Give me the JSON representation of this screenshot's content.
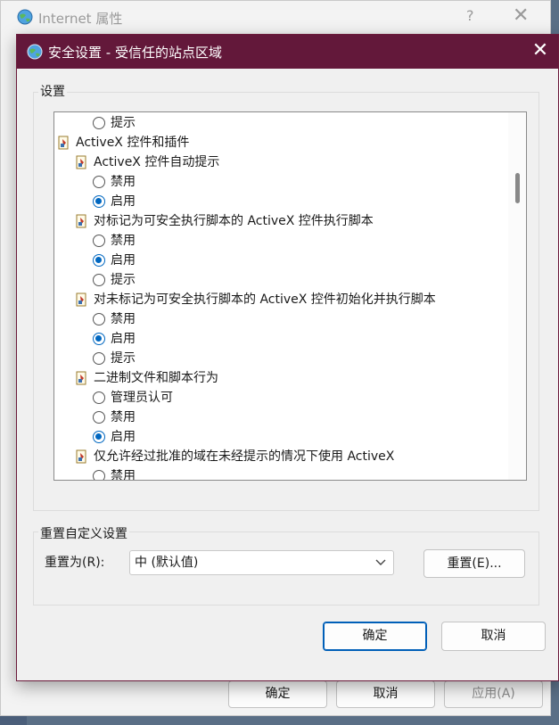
{
  "back_window": {
    "title": "Internet 属性",
    "help_glyph": "?",
    "close_glyph": "✕",
    "buttons": {
      "ok": "确定",
      "cancel": "取消",
      "apply": "应用(A)"
    }
  },
  "dialog": {
    "title": "安全设置 - 受信任的站点区域",
    "close_glyph": "✕",
    "settings_group_label": "设置",
    "tree_items": [
      {
        "type": "radio",
        "label": "提示",
        "checked": false,
        "level": 2
      },
      {
        "type": "folder",
        "label": "ActiveX 控件和插件",
        "level": 0
      },
      {
        "type": "folder",
        "label": "ActiveX 控件自动提示",
        "level": 1
      },
      {
        "type": "radio",
        "label": "禁用",
        "checked": false,
        "level": 2
      },
      {
        "type": "radio",
        "label": "启用",
        "checked": true,
        "level": 2
      },
      {
        "type": "folder",
        "label": "对标记为可安全执行脚本的 ActiveX 控件执行脚本",
        "level": 1
      },
      {
        "type": "radio",
        "label": "禁用",
        "checked": false,
        "level": 2
      },
      {
        "type": "radio",
        "label": "启用",
        "checked": true,
        "level": 2
      },
      {
        "type": "radio",
        "label": "提示",
        "checked": false,
        "level": 2
      },
      {
        "type": "folder",
        "label": "对未标记为可安全执行脚本的 ActiveX 控件初始化并执行脚本",
        "level": 1
      },
      {
        "type": "radio",
        "label": "禁用",
        "checked": false,
        "level": 2
      },
      {
        "type": "radio",
        "label": "启用",
        "checked": true,
        "level": 2
      },
      {
        "type": "radio",
        "label": "提示",
        "checked": false,
        "level": 2
      },
      {
        "type": "folder",
        "label": "二进制文件和脚本行为",
        "level": 1
      },
      {
        "type": "radio",
        "label": "管理员认可",
        "checked": false,
        "level": 2
      },
      {
        "type": "radio",
        "label": "禁用",
        "checked": false,
        "level": 2
      },
      {
        "type": "radio",
        "label": "启用",
        "checked": true,
        "level": 2
      },
      {
        "type": "folder",
        "label": "仅允许经过批准的域在未经提示的情况下使用 ActiveX",
        "level": 1
      },
      {
        "type": "radio",
        "label": "禁用",
        "checked": false,
        "level": 2
      }
    ],
    "reset_group_label": "重置自定义设置",
    "reset_to_label": "重置为(R):",
    "reset_select_value": "中 (默认值)",
    "reset_button": "重置(E)...",
    "ok_button": "确定",
    "cancel_button": "取消"
  },
  "colors": {
    "titlebar": "#63183a",
    "accent": "#0067c0"
  }
}
